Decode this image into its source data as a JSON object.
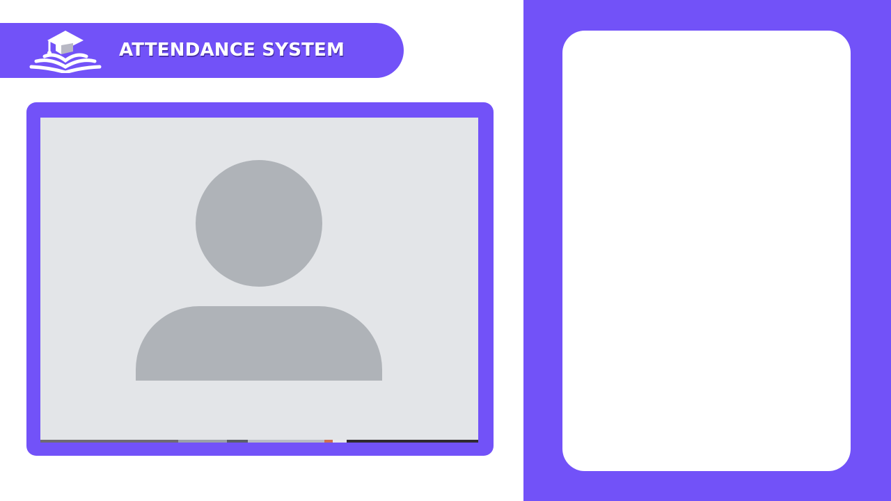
{
  "header": {
    "title": "ATTENDANCE SYSTEM",
    "logo_icon": "graduation-cap-book-icon"
  },
  "camera": {
    "placeholder_icon": "user-avatar-placeholder-icon"
  },
  "colors": {
    "accent": "#7252f8",
    "feed_background": "#e3e5e8",
    "avatar_fill": "#afb3b8",
    "card_background": "#ffffff"
  }
}
